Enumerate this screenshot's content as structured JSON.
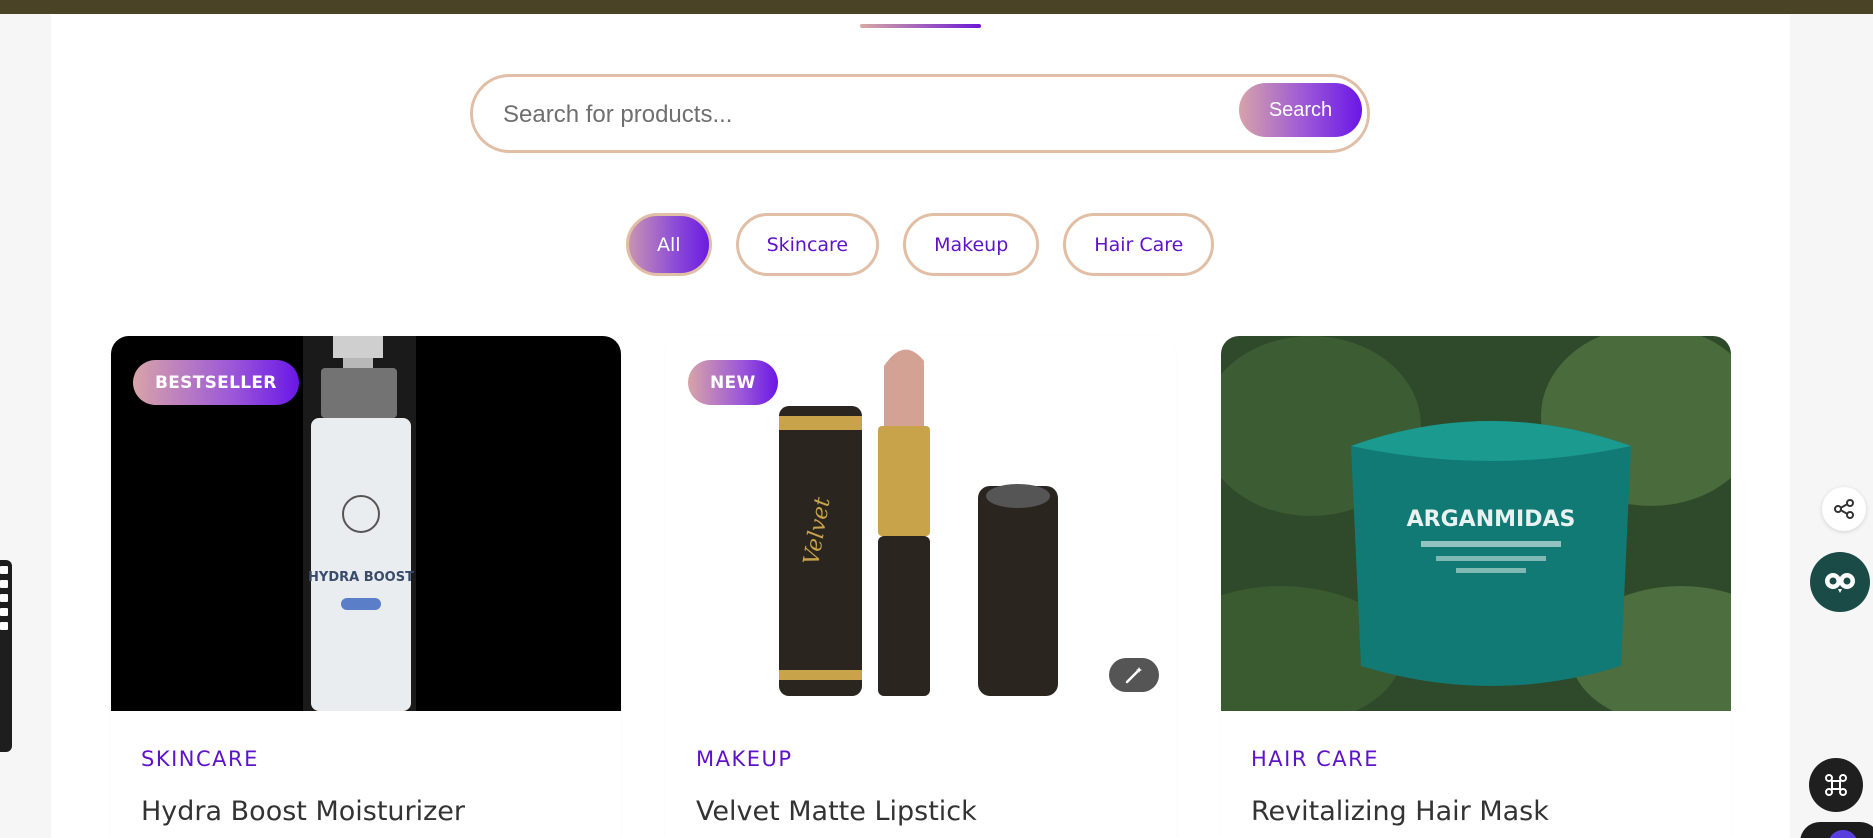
{
  "search": {
    "placeholder": "Search for products...",
    "button_label": "Search"
  },
  "filters": [
    {
      "label": "All",
      "active": true
    },
    {
      "label": "Skincare",
      "active": false
    },
    {
      "label": "Makeup",
      "active": false
    },
    {
      "label": "Hair Care",
      "active": false
    }
  ],
  "products": [
    {
      "badge": "BESTSELLER",
      "category": "SKINCARE",
      "title": "Hydra Boost Moisturizer",
      "image_text": [
        "HYDRA BOOST"
      ]
    },
    {
      "badge": "NEW",
      "category": "MAKEUP",
      "title": "Velvet Matte Lipstick",
      "image_text": [
        "Velvet"
      ]
    },
    {
      "badge": "",
      "category": "HAIR CARE",
      "title": "Revitalizing Hair Mask",
      "image_text": [
        "ARGANMIDAS"
      ]
    }
  ],
  "colors": {
    "accent": "#5e12c9",
    "chip_border": "#e1bfa6",
    "top_strip": "#4a4326",
    "gradient_start": "#d8a4a8",
    "gradient_end": "#6a17e6"
  },
  "icons": {
    "share": "share-icon",
    "owl": "owl-assistant-icon",
    "apps": "command-icon",
    "magic": "magic-wand-icon"
  }
}
